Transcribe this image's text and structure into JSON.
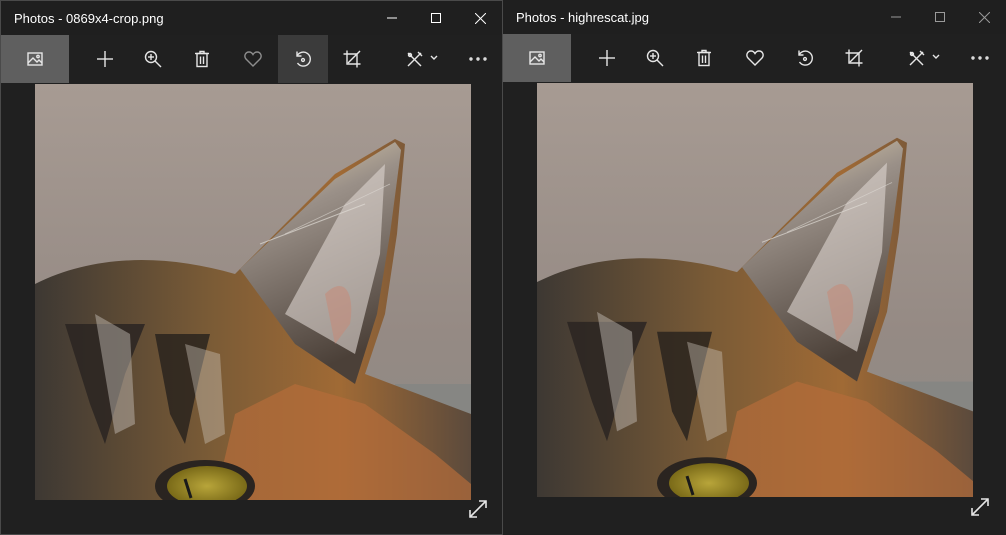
{
  "windows": [
    {
      "title": "Photos - 0869x4-crop.png",
      "active": true,
      "toolbar": [
        "picture-icon",
        "add-icon",
        "zoom-in-icon",
        "delete-icon",
        "favorite-heart-icon",
        "rotate-icon",
        "crop-icon",
        "edit-draw-icon",
        "more-icon"
      ]
    },
    {
      "title": "Photos - highrescat.jpg",
      "active": false,
      "toolbar": [
        "picture-icon",
        "add-icon",
        "zoom-in-icon",
        "delete-icon",
        "favorite-heart-icon",
        "rotate-icon",
        "crop-icon",
        "edit-draw-icon",
        "more-icon"
      ]
    }
  ],
  "image_subject": "cat-ear-photo",
  "colors": {
    "window_bg": "#202020",
    "active_tool_bg": "#5f5f5f",
    "hover_tool_bg": "#3b3b3b",
    "icon": "#e6e6e6"
  }
}
